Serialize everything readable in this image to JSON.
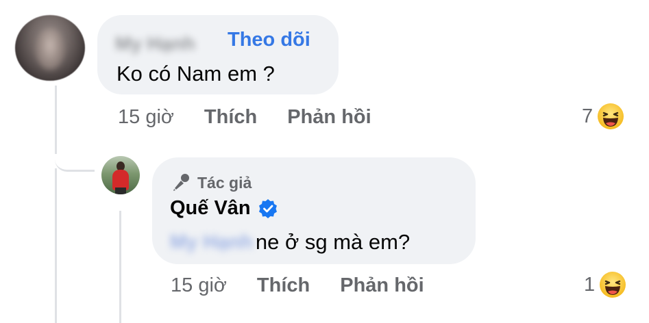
{
  "comment": {
    "author_name": "My Hạnh",
    "follow_label": "Theo dõi",
    "text": "Ko có Nam em ?",
    "time": "15 giờ",
    "like_label": "Thích",
    "reply_label": "Phản hồi",
    "reaction_count": "7",
    "reaction_icon": "haha-emoji-icon"
  },
  "reply": {
    "author_tag": "Tác giả",
    "author_name": "Quế Vân",
    "verified_icon": "verified-badge-icon",
    "mention": "My Hạnh",
    "text": "ne ở sg mà em?",
    "time": "15 giờ",
    "like_label": "Thích",
    "reply_label": "Phản hồi",
    "reaction_count": "1",
    "reaction_icon": "haha-emoji-icon"
  },
  "colors": {
    "bubble": "#f0f2f5",
    "link": "#3578e5",
    "secondary_text": "#65676b",
    "verified": "#1877f2"
  }
}
